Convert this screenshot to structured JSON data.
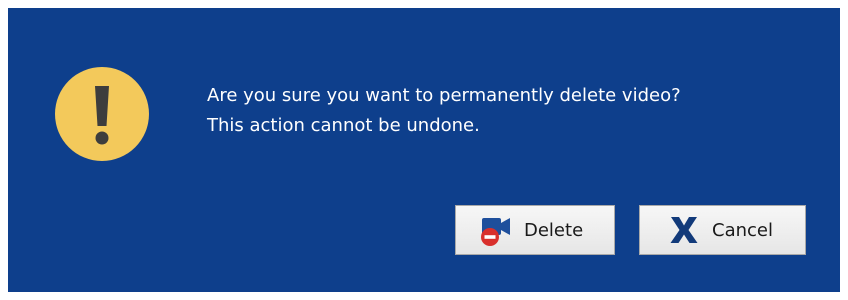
{
  "dialog": {
    "background_color": "#0e3f8c",
    "icon": "warning-exclamation-icon",
    "message_line1": "Are you sure you want to permanently delete video?",
    "message_line2": "This action cannot be undone."
  },
  "buttons": {
    "delete": {
      "label": "Delete",
      "icon": "delete-video-icon"
    },
    "cancel": {
      "label": "Cancel",
      "icon": "cancel-x-icon"
    }
  }
}
